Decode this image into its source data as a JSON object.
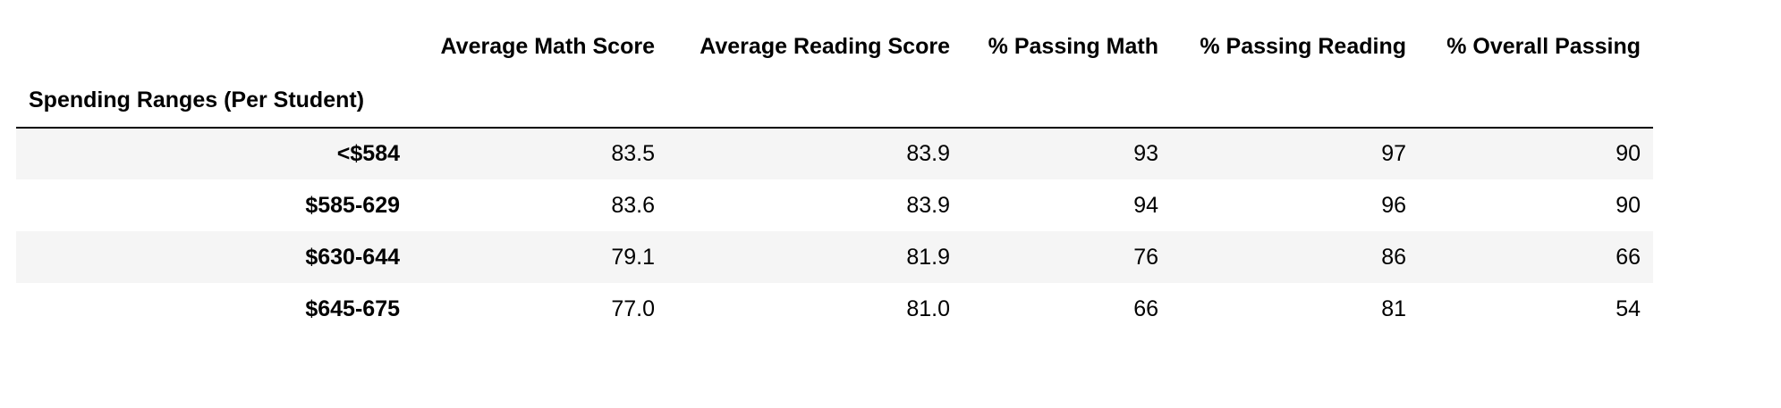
{
  "table": {
    "index_name": "Spending Ranges (Per Student)",
    "columns": [
      "Average Math Score",
      "Average Reading Score",
      "% Passing Math",
      "% Passing Reading",
      "% Overall Passing"
    ],
    "rows": [
      {
        "index": "<$584",
        "cells": [
          "83.5",
          "83.9",
          "93",
          "97",
          "90"
        ]
      },
      {
        "index": "$585-629",
        "cells": [
          "83.6",
          "83.9",
          "94",
          "96",
          "90"
        ]
      },
      {
        "index": "$630-644",
        "cells": [
          "79.1",
          "81.9",
          "76",
          "86",
          "66"
        ]
      },
      {
        "index": "$645-675",
        "cells": [
          "77.0",
          "81.0",
          "66",
          "81",
          "54"
        ]
      }
    ]
  }
}
